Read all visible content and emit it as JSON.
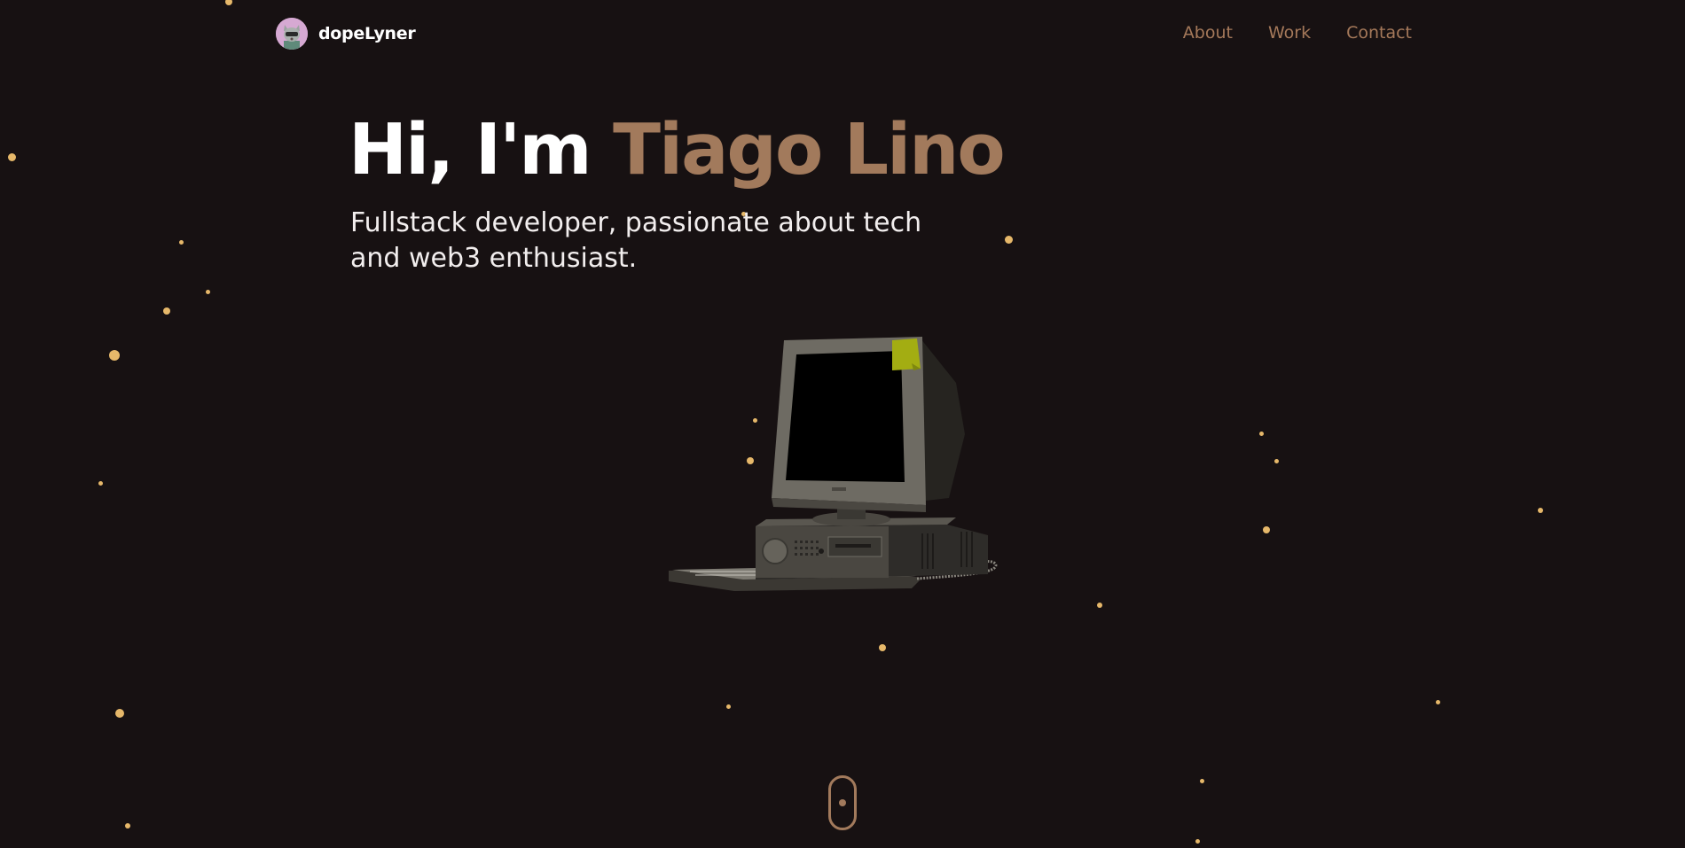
{
  "header": {
    "brand_name": "dopeLyner",
    "nav": [
      {
        "label": "About"
      },
      {
        "label": "Work"
      },
      {
        "label": "Contact"
      }
    ]
  },
  "hero": {
    "greeting": "Hi, I'm ",
    "name": "Tiago Lino",
    "subtitle": "Fullstack developer, passionate about tech and web3 enthusiast."
  },
  "colors": {
    "background": "#171112",
    "accent": "#a27a5c",
    "particle": "#e6b86a",
    "text": "#ffffff"
  },
  "icons": {
    "avatar": "avatar-icon",
    "computer": "retro-computer-icon",
    "scroll": "mouse-scroll-icon"
  }
}
